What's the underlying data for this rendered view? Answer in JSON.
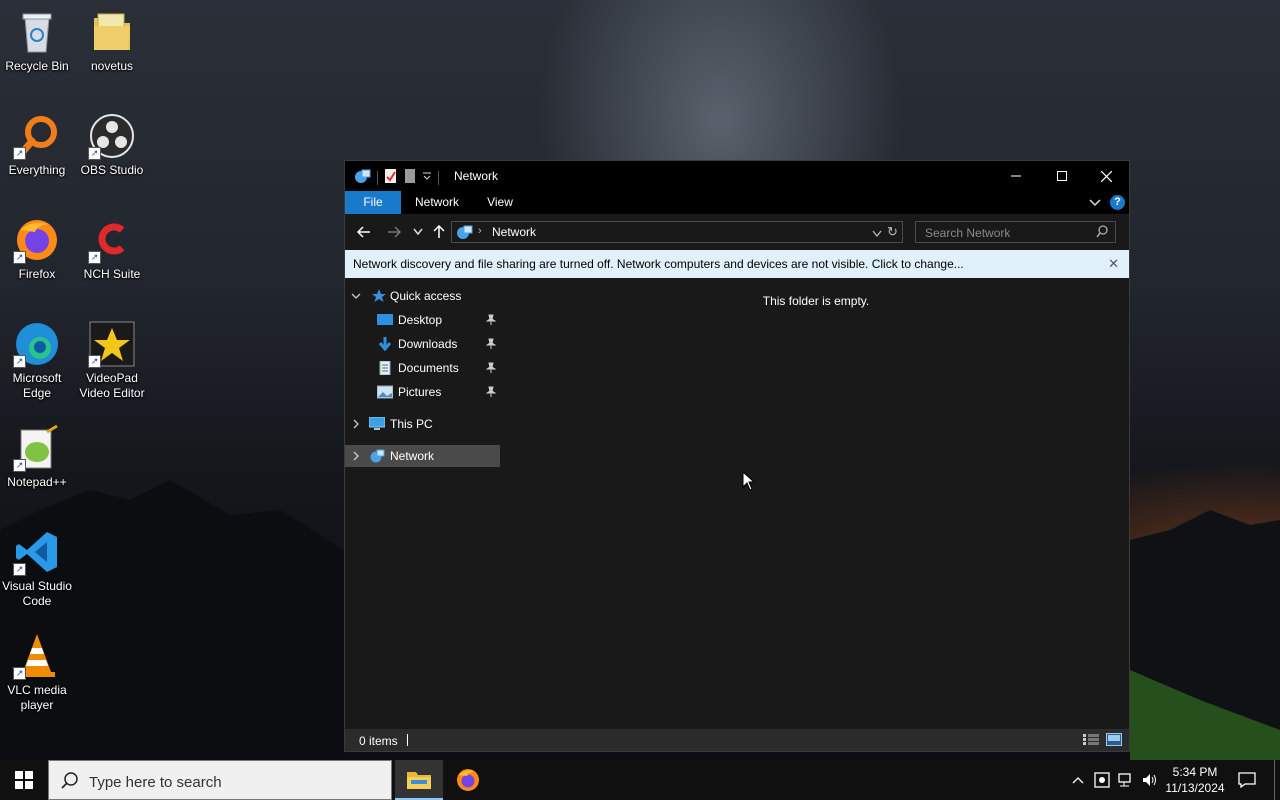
{
  "desktop": {
    "icons": [
      {
        "label": "Recycle Bin",
        "icon": "recycle-bin-icon"
      },
      {
        "label": "novetus",
        "icon": "folder-icon"
      },
      {
        "label": "Everything",
        "icon": "everything-icon"
      },
      {
        "label": "OBS Studio",
        "icon": "obs-studio-icon"
      },
      {
        "label": "Firefox",
        "icon": "firefox-icon"
      },
      {
        "label": "NCH Suite",
        "icon": "nch-suite-icon"
      },
      {
        "label": "Microsoft Edge",
        "icon": "edge-icon"
      },
      {
        "label": "VideoPad Video Editor",
        "icon": "videopad-icon"
      },
      {
        "label": "Notepad++",
        "icon": "notepadpp-icon"
      },
      {
        "label": "Visual Studio Code",
        "icon": "vscode-icon"
      },
      {
        "label": "VLC media player",
        "icon": "vlc-icon"
      }
    ]
  },
  "window": {
    "title": "Network",
    "ribbon_tabs": [
      "File",
      "Network",
      "View"
    ],
    "address": {
      "path": "Network"
    },
    "search": {
      "placeholder": "Search Network"
    },
    "infobar": {
      "message": "Network discovery and file sharing are turned off. Network computers and devices are not visible. Click to change..."
    },
    "nav": {
      "quick_access": "Quick access",
      "pinned": [
        "Desktop",
        "Downloads",
        "Documents",
        "Pictures"
      ],
      "this_pc": "This PC",
      "network": "Network"
    },
    "content": {
      "empty_text": "This folder is empty."
    },
    "status": {
      "items": "0 items"
    }
  },
  "taskbar": {
    "search": {
      "placeholder": "Type here to search"
    },
    "clock": {
      "time": "5:34 PM",
      "date": "11/13/2024"
    }
  },
  "colors": {
    "accent": "#1979ca",
    "infobar": "#e1f1fb",
    "window_bg": "#191919",
    "selection": "#4a4a4a"
  }
}
